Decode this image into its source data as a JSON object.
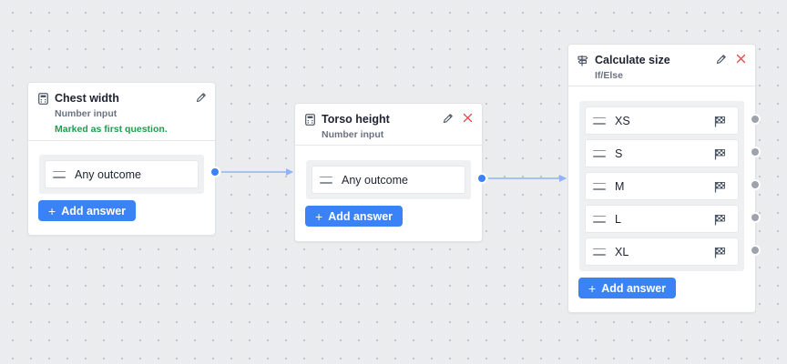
{
  "nodes": [
    {
      "title": "Chest width",
      "subtitle": "Number input",
      "note": "Marked as first question.",
      "icon": "calculator-icon",
      "actions": [
        "edit-icon"
      ],
      "answers": [
        "Any outcome"
      ],
      "add_label": "Add answer"
    },
    {
      "title": "Torso height",
      "subtitle": "Number input",
      "icon": "calculator-icon",
      "actions": [
        "edit-icon",
        "close-icon"
      ],
      "answers": [
        "Any outcome"
      ],
      "add_label": "Add answer"
    },
    {
      "title": "Calculate size",
      "subtitle": "If/Else",
      "icon": "signpost-icon",
      "actions": [
        "edit-icon",
        "close-icon"
      ],
      "answers": [
        "XS",
        "S",
        "M",
        "L",
        "XL"
      ],
      "answer_icon": "finish-flag-icon",
      "add_label": "Add answer"
    }
  ],
  "colors": {
    "accent": "#3b82f6",
    "success_note": "#1f9d4c",
    "delete": "#e5484d",
    "handle_idle": "#9ea3ab",
    "edge": "#8fb3f5"
  },
  "add_icon": "+"
}
